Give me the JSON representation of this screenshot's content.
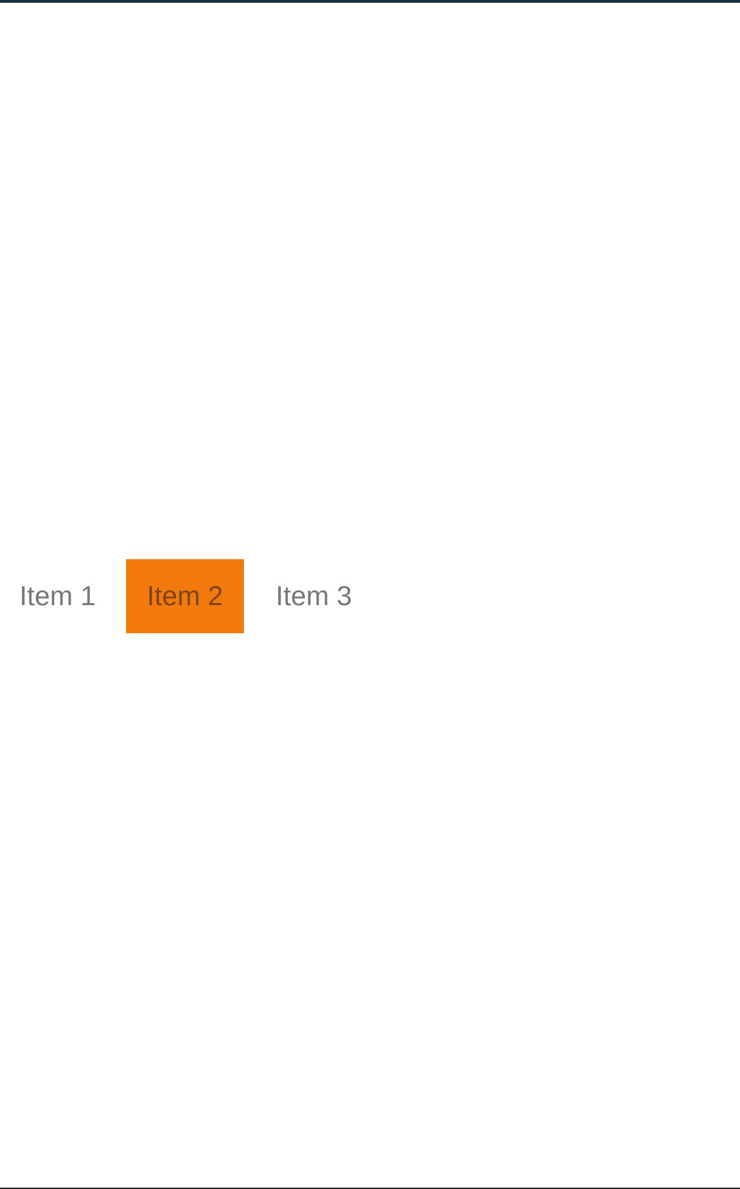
{
  "menu": {
    "items": [
      {
        "label": "Item 1",
        "selected": false
      },
      {
        "label": "Item 2",
        "selected": true
      },
      {
        "label": "Item 3",
        "selected": false
      }
    ]
  },
  "colors": {
    "top_bar": "#1b2d3b",
    "selected_bg": "#f27a0c",
    "selected_text": "#804218",
    "item_text": "#777777",
    "background": "#ffffff"
  }
}
